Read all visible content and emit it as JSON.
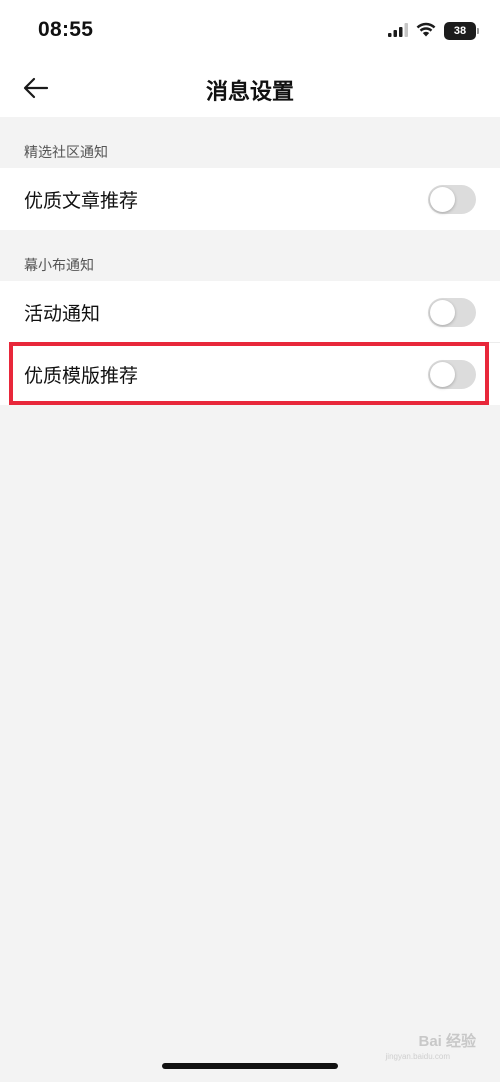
{
  "status_bar": {
    "time": "08:55",
    "battery": "38",
    "icons": [
      "cellular-signal-icon",
      "wifi-icon",
      "battery-icon"
    ]
  },
  "nav": {
    "title": "消息设置",
    "back_icon": "arrow-left-icon"
  },
  "sections": [
    {
      "header": "精选社区通知",
      "items": [
        {
          "label": "优质文章推荐",
          "enabled": false
        }
      ]
    },
    {
      "header": "幕小布通知",
      "items": [
        {
          "label": "活动通知",
          "enabled": false
        },
        {
          "label": "优质模版推荐",
          "enabled": false
        }
      ]
    }
  ],
  "highlight_color": "#e8273a",
  "watermark": {
    "brand": "Bai 经验",
    "url": "jingyan.baidu.com"
  }
}
